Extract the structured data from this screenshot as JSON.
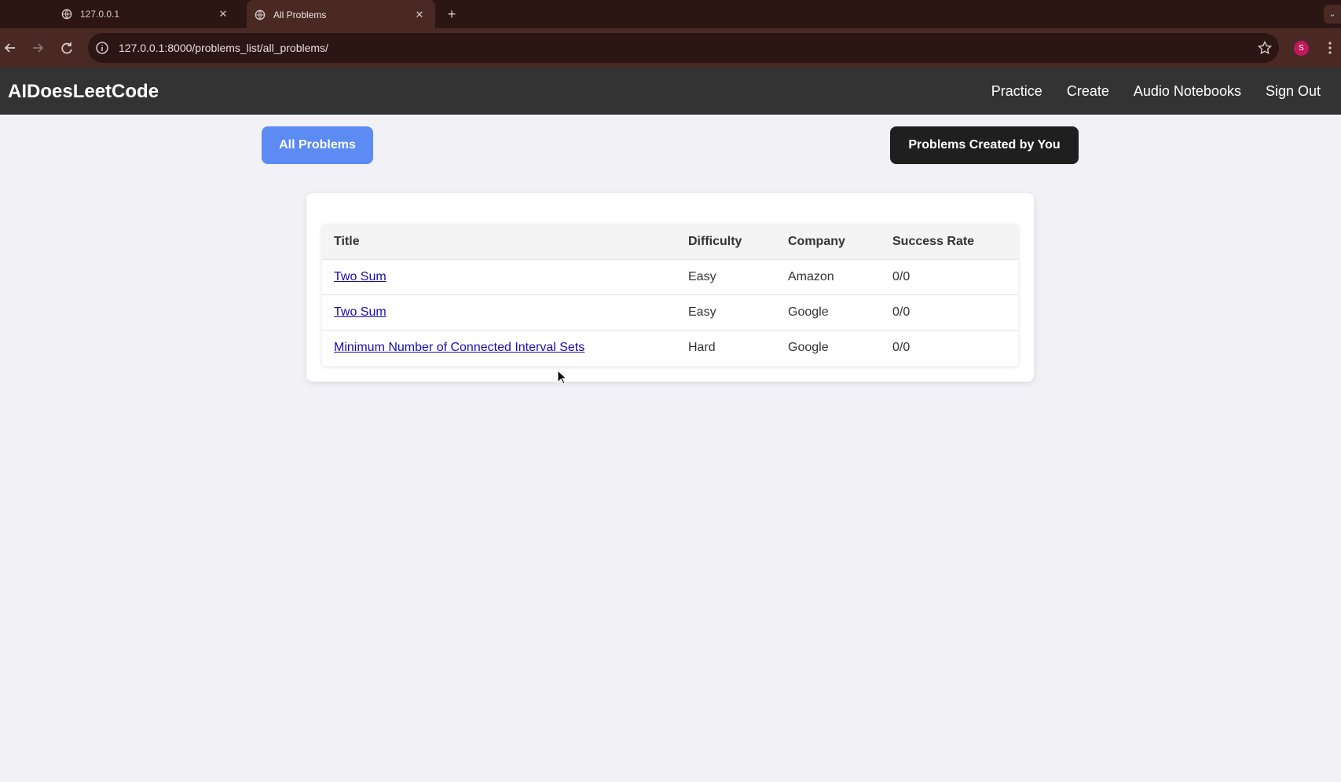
{
  "browser": {
    "tabs": [
      {
        "title": "127.0.0.1",
        "active": false
      },
      {
        "title": "All Problems",
        "active": true
      }
    ],
    "new_tab_label": "+",
    "url": "127.0.0.1:8000/problems_list/all_problems/",
    "profile_initial": "S"
  },
  "app": {
    "brand": "AIDoesLeetCode",
    "nav": [
      "Practice",
      "Create",
      "Audio Notebooks",
      "Sign Out"
    ]
  },
  "buttons": {
    "all_problems": "All Problems",
    "created_by_you": "Problems Created by You"
  },
  "table": {
    "headers": [
      "Title",
      "Difficulty",
      "Company",
      "Success Rate"
    ],
    "rows": [
      {
        "title": "Two Sum",
        "difficulty": "Easy",
        "company": "Amazon",
        "success_rate": "0/0"
      },
      {
        "title": "Two Sum",
        "difficulty": "Easy",
        "company": "Google",
        "success_rate": "0/0"
      },
      {
        "title": "Minimum Number of Connected Interval Sets",
        "difficulty": "Hard",
        "company": "Google",
        "success_rate": "0/0"
      }
    ]
  },
  "colors": {
    "primary_button": "#5b8bf3",
    "dark_button": "#1f1f1f",
    "header_bg": "#333333",
    "link": "#1a0dab"
  }
}
